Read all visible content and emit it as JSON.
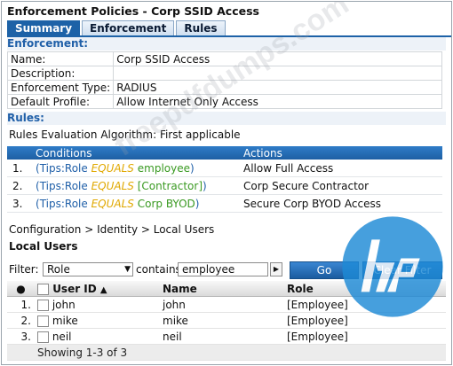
{
  "window_title": "Enforcement Policies - Corp SSID Access",
  "tabs": [
    "Summary",
    "Enforcement",
    "Rules"
  ],
  "enforcement": {
    "header": "Enforcement:",
    "fields": [
      {
        "label": "Name:",
        "value": "Corp SSID Access"
      },
      {
        "label": "Description:",
        "value": ""
      },
      {
        "label": "Enforcement Type:",
        "value": "RADIUS"
      },
      {
        "label": "Default Profile:",
        "value": "Allow Internet Only Access"
      }
    ]
  },
  "rules": {
    "header": "Rules:",
    "algorithm": "Rules Evaluation Algorithm: First applicable",
    "columns": {
      "conditions": "Conditions",
      "actions": "Actions"
    },
    "rows": [
      {
        "num": "1.",
        "open": "(",
        "attr": "Tips:Role",
        "op": "EQUALS",
        "val": "employee",
        "close": ")",
        "action": "Allow Full Access"
      },
      {
        "num": "2.",
        "open": "(",
        "attr": "Tips:Role",
        "op": "EQUALS",
        "val": "[Contractor]",
        "close": ")",
        "action": "Corp Secure Contractor"
      },
      {
        "num": "3.",
        "open": "(",
        "attr": "Tips:Role",
        "op": "EQUALS",
        "val": "Corp BYOD",
        "close": ")",
        "action": "Secure Corp BYOD Access"
      }
    ]
  },
  "breadcrumb": "Configuration > Identity > Local Users",
  "local_users": {
    "title": "Local Users",
    "filter": {
      "label": "Filter:",
      "field": "Role",
      "contains_label": "contains",
      "value": "employee",
      "go_label": "Go",
      "clear_label": "Clear Filter"
    },
    "columns": {
      "num": "●",
      "user_id": "User ID",
      "name": "Name",
      "role": "Role"
    },
    "rows": [
      {
        "num": "1.",
        "user_id": "john",
        "name": "john",
        "role": "[Employee]"
      },
      {
        "num": "2.",
        "user_id": "mike",
        "name": "mike",
        "role": "[Employee]"
      },
      {
        "num": "3.",
        "user_id": "neil",
        "name": "neil",
        "role": "[Employee]"
      }
    ],
    "footer": "Showing 1-3 of 3"
  },
  "watermark": "freepdfdumps.com",
  "colors": {
    "accent": "#1d62a7",
    "header_text": "#1f5fa8",
    "operator": "#e0a800",
    "value": "#3a9a22",
    "logo": "#1e8ad6"
  }
}
